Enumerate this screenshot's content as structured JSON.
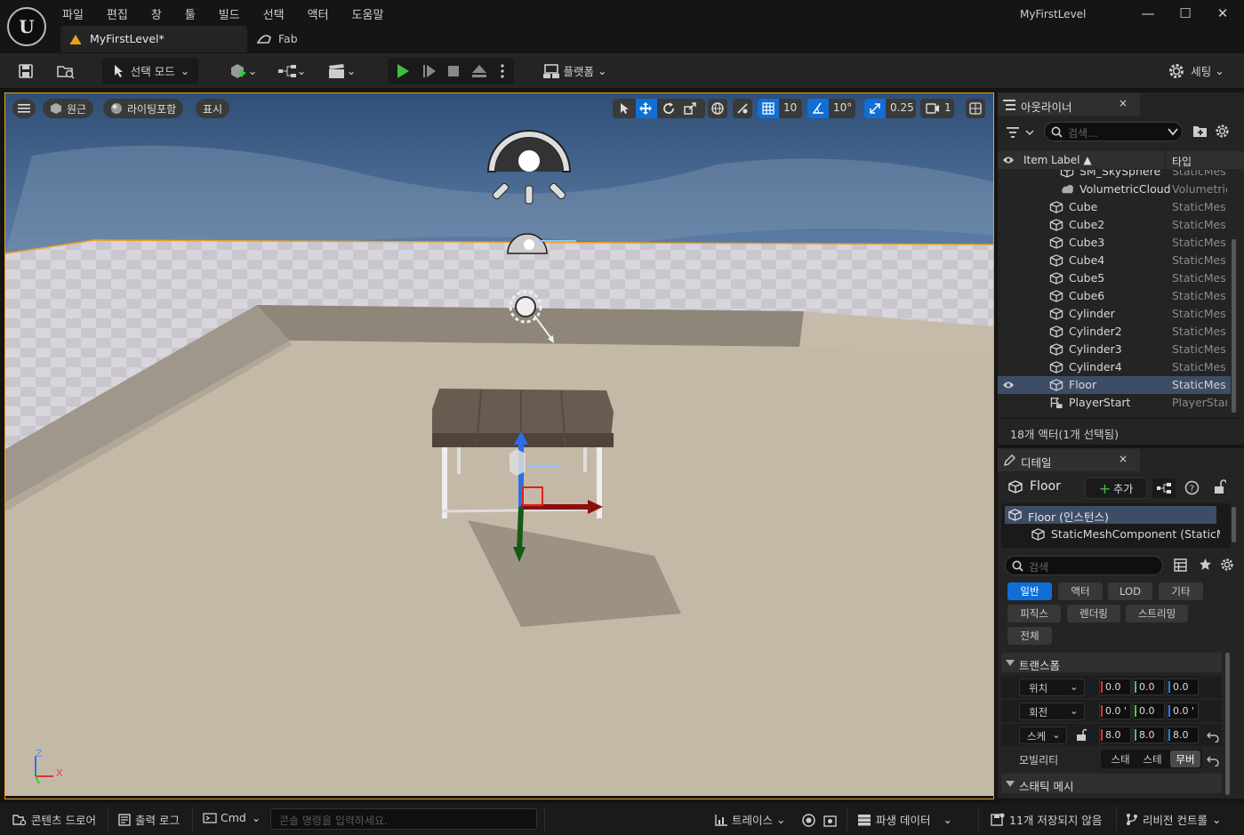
{
  "menu": [
    "파일",
    "편집",
    "창",
    "툴",
    "빌드",
    "선택",
    "액터",
    "도움말"
  ],
  "window_title": "MyFirstLevel",
  "tabs": {
    "level": "MyFirstLevel*",
    "fab": "Fab"
  },
  "toolbar": {
    "select_mode": "선택 모드",
    "platform": "플랫폼",
    "settings": "세팅"
  },
  "viewport": {
    "perspective": "원근",
    "lighting": "라이팅포함",
    "show": "표시",
    "grid_snap": "10",
    "rot_snap": "10°",
    "scale_snap": "0.25",
    "camera_speed": "1",
    "axis_z": "Z",
    "axis_x": "X"
  },
  "outliner": {
    "title": "아웃라이너",
    "close": "×",
    "search_placeholder": "검색...",
    "col_label": "Item Label ▲",
    "col_type": "타입",
    "items": [
      {
        "name": "SM_SkySphere",
        "type": "StaticMes",
        "icon": "mesh-icon"
      },
      {
        "name": "VolumetricCloud",
        "type": "Volumetric",
        "icon": "cloud-icon"
      },
      {
        "name": "Cube",
        "type": "StaticMes",
        "icon": "mesh-icon"
      },
      {
        "name": "Cube2",
        "type": "StaticMes",
        "icon": "mesh-icon"
      },
      {
        "name": "Cube3",
        "type": "StaticMes",
        "icon": "mesh-icon"
      },
      {
        "name": "Cube4",
        "type": "StaticMes",
        "icon": "mesh-icon"
      },
      {
        "name": "Cube5",
        "type": "StaticMes",
        "icon": "mesh-icon"
      },
      {
        "name": "Cube6",
        "type": "StaticMes",
        "icon": "mesh-icon"
      },
      {
        "name": "Cylinder",
        "type": "StaticMes",
        "icon": "mesh-icon"
      },
      {
        "name": "Cylinder2",
        "type": "StaticMes",
        "icon": "mesh-icon"
      },
      {
        "name": "Cylinder3",
        "type": "StaticMes",
        "icon": "mesh-icon"
      },
      {
        "name": "Cylinder4",
        "type": "StaticMes",
        "icon": "mesh-icon"
      },
      {
        "name": "Floor",
        "type": "StaticMes",
        "icon": "mesh-icon"
      },
      {
        "name": "PlayerStart",
        "type": "PlayerStar",
        "icon": "player-start-icon"
      }
    ],
    "footer": "18개 액터(1개 선택됨)"
  },
  "details": {
    "title": "디테일",
    "close": "×",
    "object_name": "Floor",
    "add_label": "추가",
    "component_root": "Floor (인스턴스)",
    "component_child": "StaticMeshComponent (StaticMe",
    "search_placeholder": "검색",
    "categories": [
      "일반",
      "액터",
      "LOD",
      "기타",
      "피직스",
      "렌더링",
      "스트리밍",
      "전체"
    ],
    "transform_title": "트랜스폼",
    "location_label": "위치",
    "rotation_label": "회전",
    "scale_label": "스케",
    "location": [
      "0.0",
      "0.0",
      "0.0"
    ],
    "rotation": [
      "0.0 '",
      "0.0",
      "0.0 '"
    ],
    "scale": [
      "8.0",
      "8.0",
      "8.0"
    ],
    "mobility_label": "모빌리티",
    "mobility_options": [
      "스태",
      "스테",
      "무버"
    ],
    "static_mesh_title": "스태틱 메시"
  },
  "statusbar": {
    "content_drawer": "콘텐츠 드로어",
    "output_log": "출력 로그",
    "cmd": "Cmd",
    "cmd_placeholder": "콘솔 명령을 입력하세요.",
    "trace": "트레이스",
    "derived_data": "파생 데이터",
    "unsaved": "11개 저장되지 않음",
    "revision_control": "리비전 컨트롤"
  },
  "colors": {
    "accent": "#0f6fd6",
    "viewport_border": "#e8a020",
    "selected_row": "#3e4d66"
  }
}
